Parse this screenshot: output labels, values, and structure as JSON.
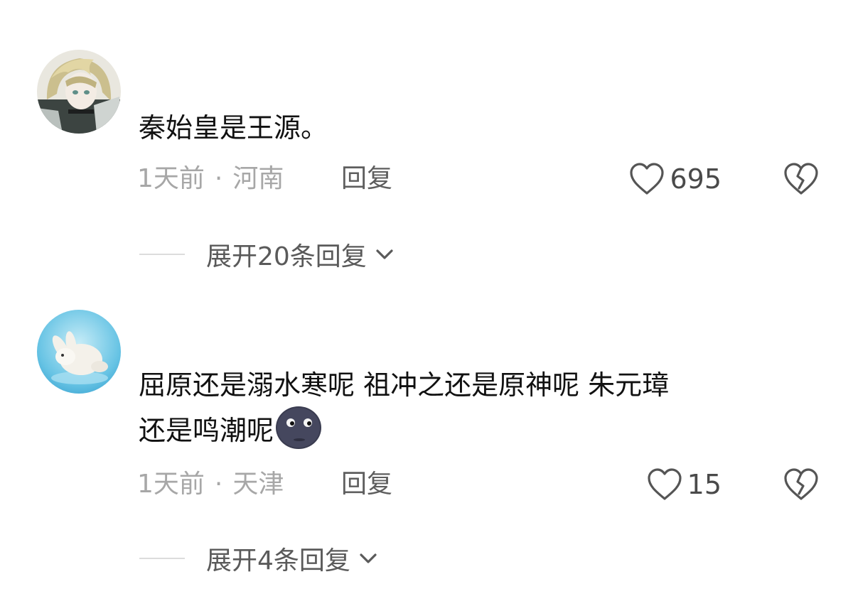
{
  "comments": [
    {
      "avatar": "anime-character-avatar",
      "text": "秦始皇是王源。",
      "time": "1天前",
      "separator": "·",
      "location": "河南",
      "reply_label": "回复",
      "likes": "695",
      "expand_label": "展开20条回复"
    },
    {
      "avatar": "white-rabbit-avatar",
      "text": "屈原还是溺水寒呢 祖冲之还是原神呢 朱元璋\n还是鸣潮呢",
      "emoji": "new-moon-face-emoji",
      "time": "1天前",
      "separator": "·",
      "location": "天津",
      "reply_label": "回复",
      "likes": "15",
      "expand_label": "展开4条回复"
    }
  ],
  "colors": {
    "text": "#111111",
    "meta": "#a7a7a7",
    "reply": "#5e5e5e",
    "icon": "#555555",
    "divider": "#dcdcdc"
  }
}
